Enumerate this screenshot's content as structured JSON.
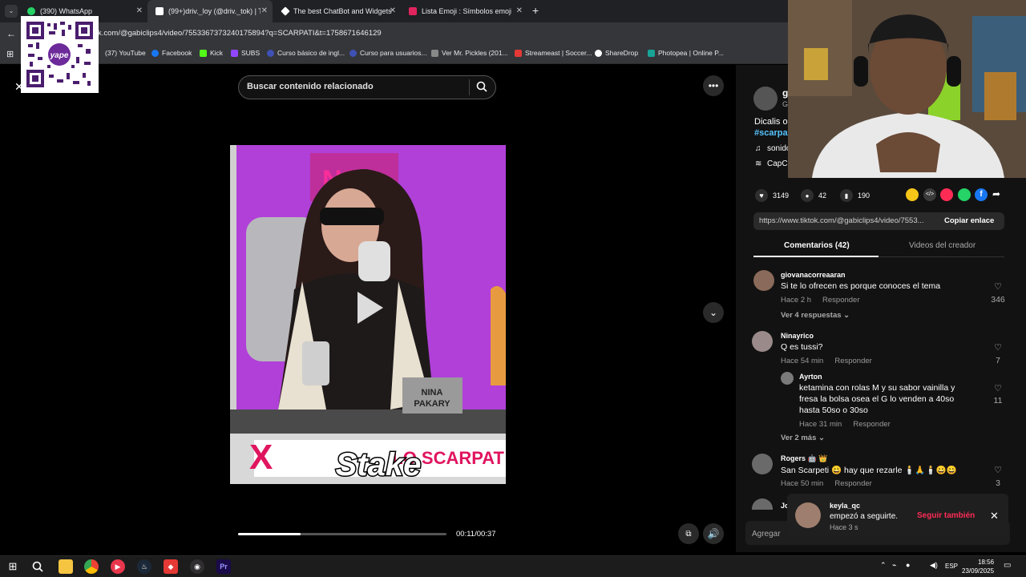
{
  "browser": {
    "tabs": [
      {
        "label": "(390) WhatsApp",
        "color": "#25d366"
      },
      {
        "label": "(99+)driv._loy (@driv._tok) | Ti",
        "color": "#ffffff"
      },
      {
        "label": "The best ChatBot and Widgets",
        "color": "#ffffff"
      },
      {
        "label": "Lista Emoji : Símbolos emoji na",
        "color": "#e0245e"
      }
    ],
    "new_tab": "+",
    "url": "k.com/@gabiclips4/video/7553367373240175894?q=SCARPATI&t=1758671646129",
    "bookmarks": [
      {
        "label": "(37) YouTube",
        "color": "#ff0000"
      },
      {
        "label": "Facebook",
        "color": "#1877f2"
      },
      {
        "label": "Kick",
        "color": "#53fc18"
      },
      {
        "label": "SUBS",
        "color": "#9146ff"
      },
      {
        "label": "Curso básico de ingl...",
        "color": "#3f51b5"
      },
      {
        "label": "Curso para usuarios...",
        "color": "#3f51b5"
      },
      {
        "label": "Ver Mr. Pickles (201...",
        "color": "#888888"
      },
      {
        "label": "Streameast | Soccer...",
        "color": "#e53935"
      },
      {
        "label": "ShareDrop",
        "color": "#ffffff"
      },
      {
        "label": "Photopea | Online P...",
        "color": "#18a497"
      }
    ]
  },
  "qr_label": "yape",
  "search": {
    "placeholder": "Buscar contenido relacionado"
  },
  "video": {
    "overlay_brand": "Stake",
    "banner_text": "LO SCARPAT",
    "nameplate_line1": "NINA",
    "nameplate_line2": "PAKARY",
    "time": "00:11/00:37",
    "progress": 0.3
  },
  "post": {
    "author_initial": "g",
    "author_sub": "G",
    "caption": "Dicalis o",
    "hashtag": "#scarpat",
    "sound": "sonido",
    "capcut": "CapCu",
    "likes": "3149",
    "comments": "42",
    "saves": "190",
    "share_url": "https://www.tiktok.com/@gabiclips4/video/7553...",
    "copy_label": "Copiar enlace"
  },
  "tabs": {
    "comments": "Comentarios (42)",
    "creator_videos": "Videos del creador"
  },
  "comments": [
    {
      "user": "giovanacorreaaran",
      "text": "Si te lo ofrecen es porque conoces el tema",
      "time": "Hace 2 h",
      "reply": "Responder",
      "likes": "346",
      "more": "Ver 4 respuestas"
    },
    {
      "user": "Ninayrico",
      "text": "Q es tussi?",
      "time": "Hace 54 min",
      "reply": "Responder",
      "likes": "7"
    },
    {
      "user": "Ayrton",
      "text_lines": [
        "ketamina con rolas M y su sabor vainilla y",
        "fresa la bolsa osea el G lo venden a 40so",
        "hasta 50so o 30so"
      ],
      "time": "Hace 31 min",
      "reply": "Responder",
      "likes": "11",
      "more": "Ver 2 más"
    },
    {
      "user": "Rogers 🤖 👑",
      "text": "San Scarpeti 😀 hay que rezarle 🕯️🙏🕯️😀😀",
      "time": "Hace 50 min",
      "reply": "Responder",
      "likes": "3"
    }
  ],
  "cut_user": "Jo",
  "add_comment": "Agregar",
  "notification": {
    "user": "keyla_qc",
    "message": "empezó a seguirte.",
    "time": "Hace 3 s",
    "action": "Seguir también"
  },
  "taskbar": {
    "lang": "ESP",
    "time": "18:56",
    "date": "23/09/2025"
  }
}
